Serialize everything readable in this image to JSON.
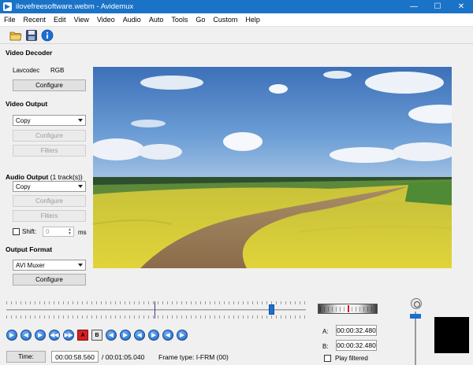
{
  "window": {
    "title": "ilovefreesoftware.webm - Avidemux",
    "minimize": "—",
    "maximize": "☐",
    "close": "✕"
  },
  "menu": [
    "File",
    "Recent",
    "Edit",
    "View",
    "Video",
    "Audio",
    "Auto",
    "Tools",
    "Go",
    "Custom",
    "Help"
  ],
  "toolbar_icons": [
    "open-folder-icon",
    "save-disk-icon",
    "info-icon"
  ],
  "video_decoder": {
    "title": "Video Decoder",
    "codec": "Lavcodec",
    "format": "RGB",
    "configure": "Configure"
  },
  "video_output": {
    "title": "Video Output",
    "selected": "Copy",
    "configure": "Configure",
    "filters": "Filters"
  },
  "audio_output": {
    "title": "Audio Output",
    "tracks": "(1 track(s))",
    "selected": "Copy",
    "configure": "Configure",
    "filters": "Filters",
    "shift_label": "Shift:",
    "shift_value": "0",
    "shift_unit": "ms"
  },
  "output_format": {
    "title": "Output Format",
    "selected": "AVI Muxer",
    "configure": "Configure"
  },
  "playback": {
    "seek_position": 0.885,
    "marker_position": 0.495,
    "volume_level": 0.96
  },
  "nav_buttons": [
    {
      "name": "play-button",
      "glyph": "▶"
    },
    {
      "name": "previous-frame-button",
      "glyph": "◀"
    },
    {
      "name": "next-frame-button",
      "glyph": "▶"
    },
    {
      "name": "previous-keyframe-button",
      "glyph": "◀◀"
    },
    {
      "name": "next-keyframe-button",
      "glyph": "▶▶"
    },
    {
      "name": "set-marker-a-button",
      "glyph": "A"
    },
    {
      "name": "set-marker-b-button",
      "glyph": "B"
    },
    {
      "name": "previous-black-frame-button",
      "glyph": "◀"
    },
    {
      "name": "next-black-frame-button",
      "glyph": "▶"
    },
    {
      "name": "first-frame-button",
      "glyph": "◀"
    },
    {
      "name": "last-frame-button",
      "glyph": "▶"
    },
    {
      "name": "previous-cut-button",
      "glyph": "◀"
    },
    {
      "name": "next-cut-button",
      "glyph": "▶"
    }
  ],
  "selection": {
    "a_label": "A:",
    "a_time": "00:00:32.480",
    "b_label": "B:",
    "b_time": "00:00:32.480",
    "play_filtered": "Play filtered"
  },
  "status": {
    "time_button": "Time:",
    "current_time": "00:00:58.560",
    "total_time": "/ 00:01:05.040",
    "frame_type": "Frame type:  I-FRM (00)"
  },
  "colors": {
    "titlebar": "#1a73c7",
    "accent": "#1b6fd0"
  }
}
